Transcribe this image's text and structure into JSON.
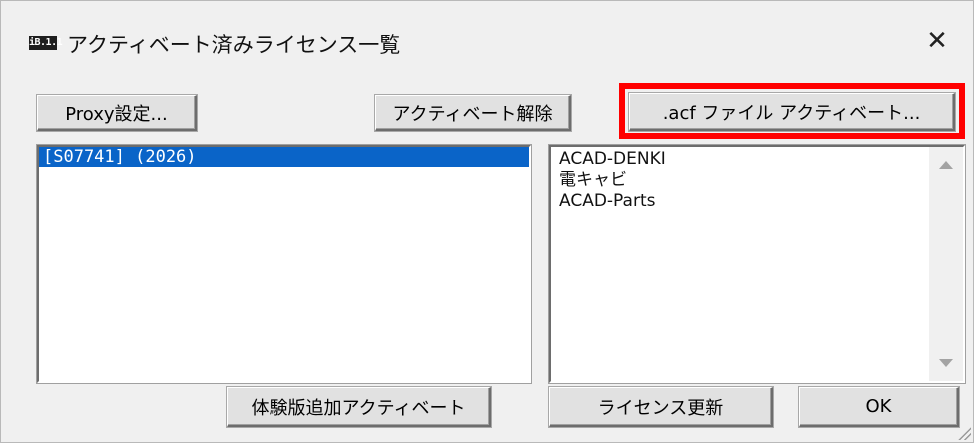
{
  "window": {
    "icon_text": "iB.1.1",
    "title": "アクティベート済みライセンス一覧",
    "close_glyph": "✕"
  },
  "toolbar": {
    "proxy_label": "Proxy設定...",
    "deactivate_label": "アクティベート解除",
    "acf_activate_label": ".acf ファイル アクティベート..."
  },
  "licenses": [
    {
      "label": "[S07741] (2026)",
      "selected": true
    }
  ],
  "products": [
    "ACAD-DENKI",
    "電キャビ",
    "ACAD-Parts"
  ],
  "footer": {
    "trial_label": "体験版追加アクティベート",
    "renew_label": "ライセンス更新",
    "ok_label": "OK"
  },
  "colors": {
    "highlight": "#ff0000",
    "selection": "#0a64c8"
  }
}
